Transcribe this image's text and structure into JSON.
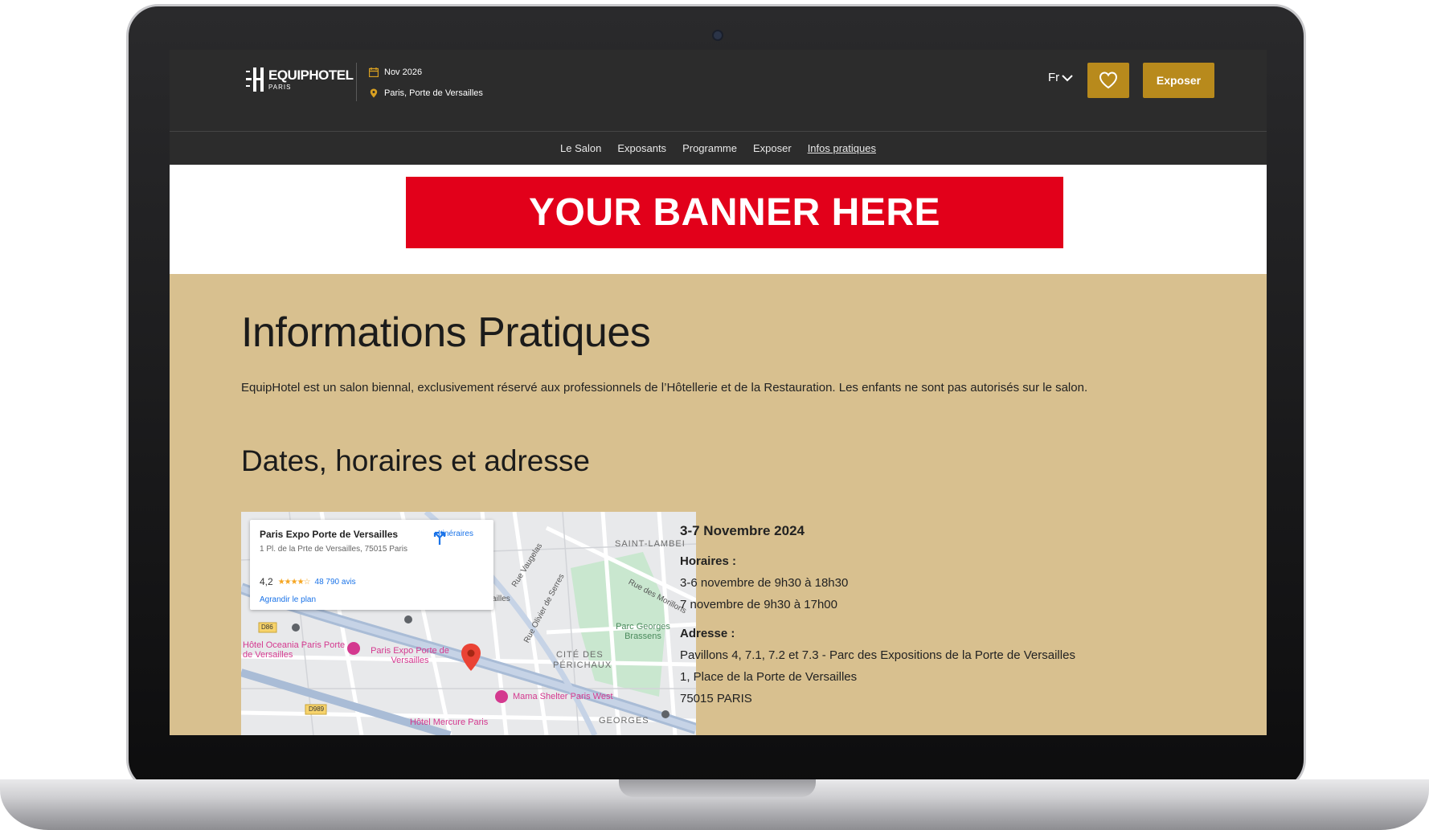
{
  "header": {
    "logo_text": "EQUIPHOTEL",
    "logo_sub": "PARIS",
    "event_date": "Nov 2026",
    "event_location": "Paris, Porte de Versailles",
    "language": "Fr",
    "expose_button": "Exposer"
  },
  "nav": {
    "items": [
      {
        "label": "Le Salon"
      },
      {
        "label": "Exposants"
      },
      {
        "label": "Programme"
      },
      {
        "label": "Exposer"
      },
      {
        "label": "Infos pratiques",
        "active": true
      }
    ]
  },
  "banner": {
    "text": "YOUR BANNER HERE",
    "color": "#e2001a"
  },
  "page": {
    "title": "Informations Pratiques",
    "intro": "EquipHotel est un salon biennal, exclusivement réservé aux professionnels de l’Hôtellerie et de la Restauration. Les enfants ne sont pas autorisés sur le salon.",
    "section_title": "Dates, horaires et adresse"
  },
  "map": {
    "place_name": "Paris Expo Porte de Versailles",
    "place_address": "1 Pl. de la Prte de Versailles, 75015 Paris",
    "rating": "4,2",
    "stars": "★★★★☆",
    "reviews": "48 790 avis",
    "enlarge_link": "Agrandir le plan",
    "route_label": "Itinéraires",
    "labels": {
      "saint_lambert": "SAINT-LAMBEI",
      "hotel_oceania": "Hôtel Oceania Paris Porte de Versailles",
      "paris_expo": "Paris Expo Porte de Versailles",
      "cite_des": "CITÉ DES",
      "perichaux": "PÉRICHAUX",
      "parc_georges": "Parc Georges Brassens",
      "mama_shelter": "Mama Shelter Paris West",
      "georges": "GEORGES",
      "rue_vaugelas": "Rue Vaugelas",
      "rue_olivier": "Rue Olivier de Serres",
      "rue_morillons": "Rue des Morillons",
      "ailles": "ailles",
      "road_d86": "D86",
      "road_d989": "D989",
      "hotel_bottom": "Hôtel Mercure Paris"
    }
  },
  "details": {
    "date": "3-7 Novembre 2024",
    "hours_label": "Horaires :",
    "hours_1": "3-6 novembre de 9h30 à 18h30",
    "hours_2": "7 novembre de 9h30 à 17h00",
    "address_label": "Adresse :",
    "address_1": "Pavillons 4, 7.1, 7.2 et 7.3 - Parc des Expositions de la Porte de Versailles",
    "address_2": "1, Place de la Porte de Versailles",
    "address_3": "75015 PARIS"
  },
  "colors": {
    "topbar": "#2c2c2c",
    "gold_button": "#b88a1c",
    "content_background": "#d8c08f"
  }
}
